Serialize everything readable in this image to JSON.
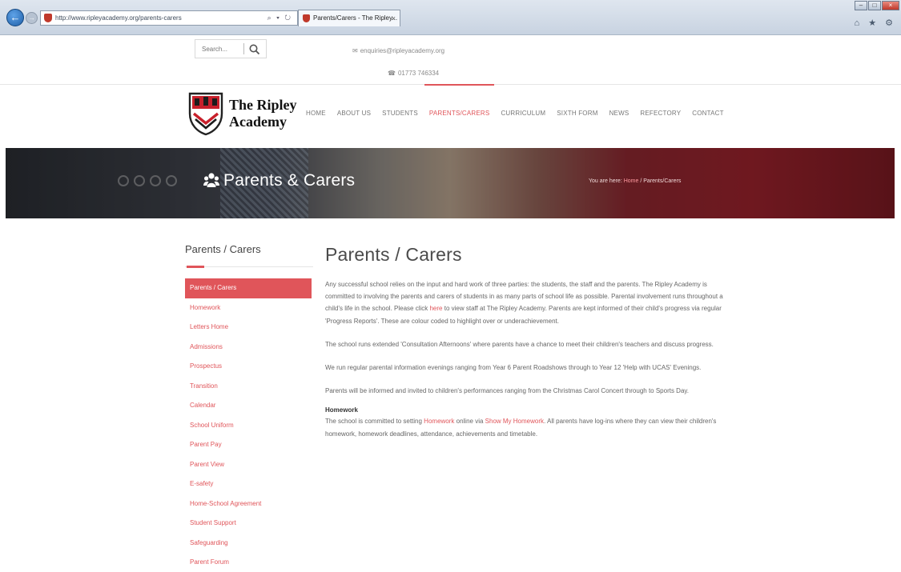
{
  "browser": {
    "address": "http://www.ripleyacademy.org/parents-carers",
    "address_controls": "⌕ ▾ ↻",
    "tab_title": "Parents/Carers - The Ripley...",
    "tab_close": "×",
    "win_min": "–",
    "win_max": "□",
    "win_close": "×",
    "right_icons": "⌂ ★ ⚙"
  },
  "topbar": {
    "search_placeholder": "Search...",
    "email": "enquiries@ripleyacademy.org",
    "phone": "01773 746334"
  },
  "logo": {
    "line1": "The Ripley",
    "line2": "Academy"
  },
  "nav": {
    "items": [
      "HOME",
      "ABOUT US",
      "STUDENTS",
      "PARENTS/CARERS",
      "CURRICULUM",
      "SIXTH FORM",
      "NEWS",
      "REFECTORY",
      "CONTACT"
    ],
    "active": "PARENTS/CARERS"
  },
  "hero": {
    "title": "Parents & Carers",
    "breadcrumb_prefix": "You are here: ",
    "breadcrumb_home": "Home",
    "breadcrumb_current": " / Parents/Carers"
  },
  "sidebar": {
    "title": "Parents / Carers",
    "items": [
      "Parents / Carers",
      "Homework",
      "Letters Home",
      "Admissions",
      "Prospectus",
      "Transition",
      "Calendar",
      "School Uniform",
      "Parent Pay",
      "Parent View",
      "E-safety",
      "Home-School Agreement",
      "Student Support",
      "Safeguarding",
      "Parent Forum"
    ],
    "active": "Parents / Carers"
  },
  "main": {
    "title": "Parents / Carers",
    "p1_a": "Any successful school relies on the input and hard work of three parties: the students, the staff and the parents.  The Ripley Academy is committed to involving the parents and carers of students in as many parts of school life as possible. Parental involvement runs throughout a child's life in the school. Please click ",
    "p1_link": "here",
    "p1_b": " to view staff at The Ripley Academy. Parents are kept informed of their child's progress via regular 'Progress Reports'.  These are colour coded to highlight over or underachievement.",
    "p2": "The school runs extended 'Consultation Afternoons' where parents have a chance to meet their children's teachers and discuss progress.",
    "p3": "We run regular parental information evenings ranging from Year 6 Parent Roadshows through to Year 12 'Help with UCAS' Evenings.",
    "p4": "Parents will be informed and invited to children's performances ranging from the Christmas Carol Concert through to Sports Day.",
    "hw_heading": "Homework",
    "hw_a": "The school is committed to setting ",
    "hw_link1": "Homework",
    "hw_b": " online via ",
    "hw_link2": "Show My Homework",
    "hw_c": ".  All parents have log-ins where they can view their children's homework, homework deadlines, attendance, achievements and timetable."
  },
  "colors": {
    "accent": "#e0555a",
    "text": "#666666",
    "heading": "#4b4b4b"
  }
}
